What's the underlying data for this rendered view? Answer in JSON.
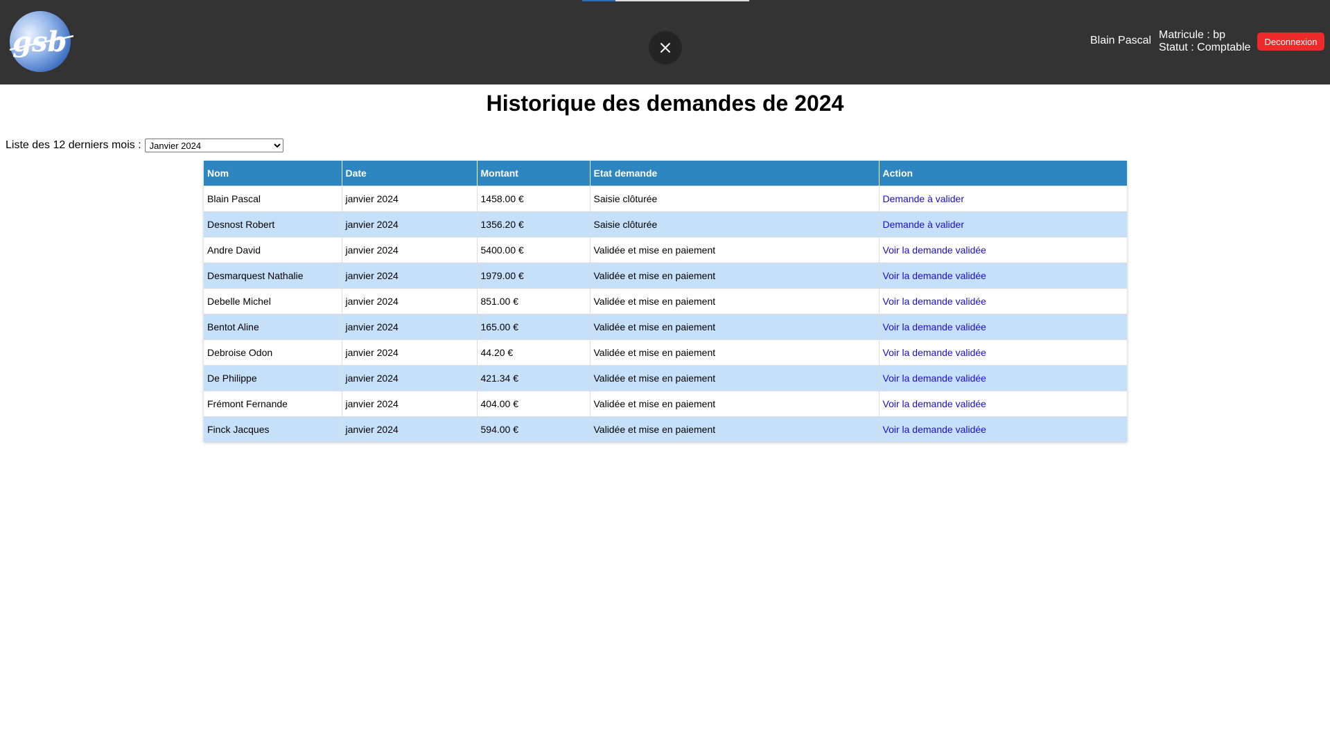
{
  "header": {
    "logo_text": "gsb",
    "close_icon": "close-icon",
    "user": {
      "name": "Blain Pascal",
      "matricule": "Matricule : bp",
      "statut": "Statut : Comptable"
    },
    "logout_label": "Deconnexion"
  },
  "main": {
    "title": "Historique des demandes de 2024",
    "filter": {
      "label": "Liste des 12 derniers mois :",
      "selected": "Janvier 2024"
    },
    "table": {
      "columns": [
        "Nom",
        "Date",
        "Montant",
        "Etat demande",
        "Action"
      ],
      "rows": [
        {
          "nom": "Blain Pascal",
          "date": "janvier 2024",
          "montant": "1458.00 €",
          "etat": "Saisie clôturée",
          "action": "Demande à valider"
        },
        {
          "nom": "Desnost Robert",
          "date": "janvier 2024",
          "montant": "1356.20 €",
          "etat": "Saisie clôturée",
          "action": "Demande à valider"
        },
        {
          "nom": "Andre David",
          "date": "janvier 2024",
          "montant": "5400.00 €",
          "etat": "Validée et mise en paiement",
          "action": "Voir la demande validée"
        },
        {
          "nom": "Desmarquest Nathalie",
          "date": "janvier 2024",
          "montant": "1979.00 €",
          "etat": "Validée et mise en paiement",
          "action": "Voir la demande validée"
        },
        {
          "nom": "Debelle Michel",
          "date": "janvier 2024",
          "montant": "851.00 €",
          "etat": "Validée et mise en paiement",
          "action": "Voir la demande validée"
        },
        {
          "nom": "Bentot Aline",
          "date": "janvier 2024",
          "montant": "165.00 €",
          "etat": "Validée et mise en paiement",
          "action": "Voir la demande validée"
        },
        {
          "nom": "Debroise Odon",
          "date": "janvier 2024",
          "montant": "44.20 €",
          "etat": "Validée et mise en paiement",
          "action": "Voir la demande validée"
        },
        {
          "nom": "De Philippe",
          "date": "janvier 2024",
          "montant": "421.34 €",
          "etat": "Validée et mise en paiement",
          "action": "Voir la demande validée"
        },
        {
          "nom": "Frémont Fernande",
          "date": "janvier 2024",
          "montant": "404.00 €",
          "etat": "Validée et mise en paiement",
          "action": "Voir la demande validée"
        },
        {
          "nom": "Finck Jacques",
          "date": "janvier 2024",
          "montant": "594.00 €",
          "etat": "Validée et mise en paiement",
          "action": "Voir la demande validée"
        }
      ]
    }
  },
  "colors": {
    "topbar": "#333333",
    "table_header": "#2e86c1",
    "row_alt": "#c7e0fa",
    "link": "#1a0dcc",
    "logout": "#ee2a2a"
  }
}
